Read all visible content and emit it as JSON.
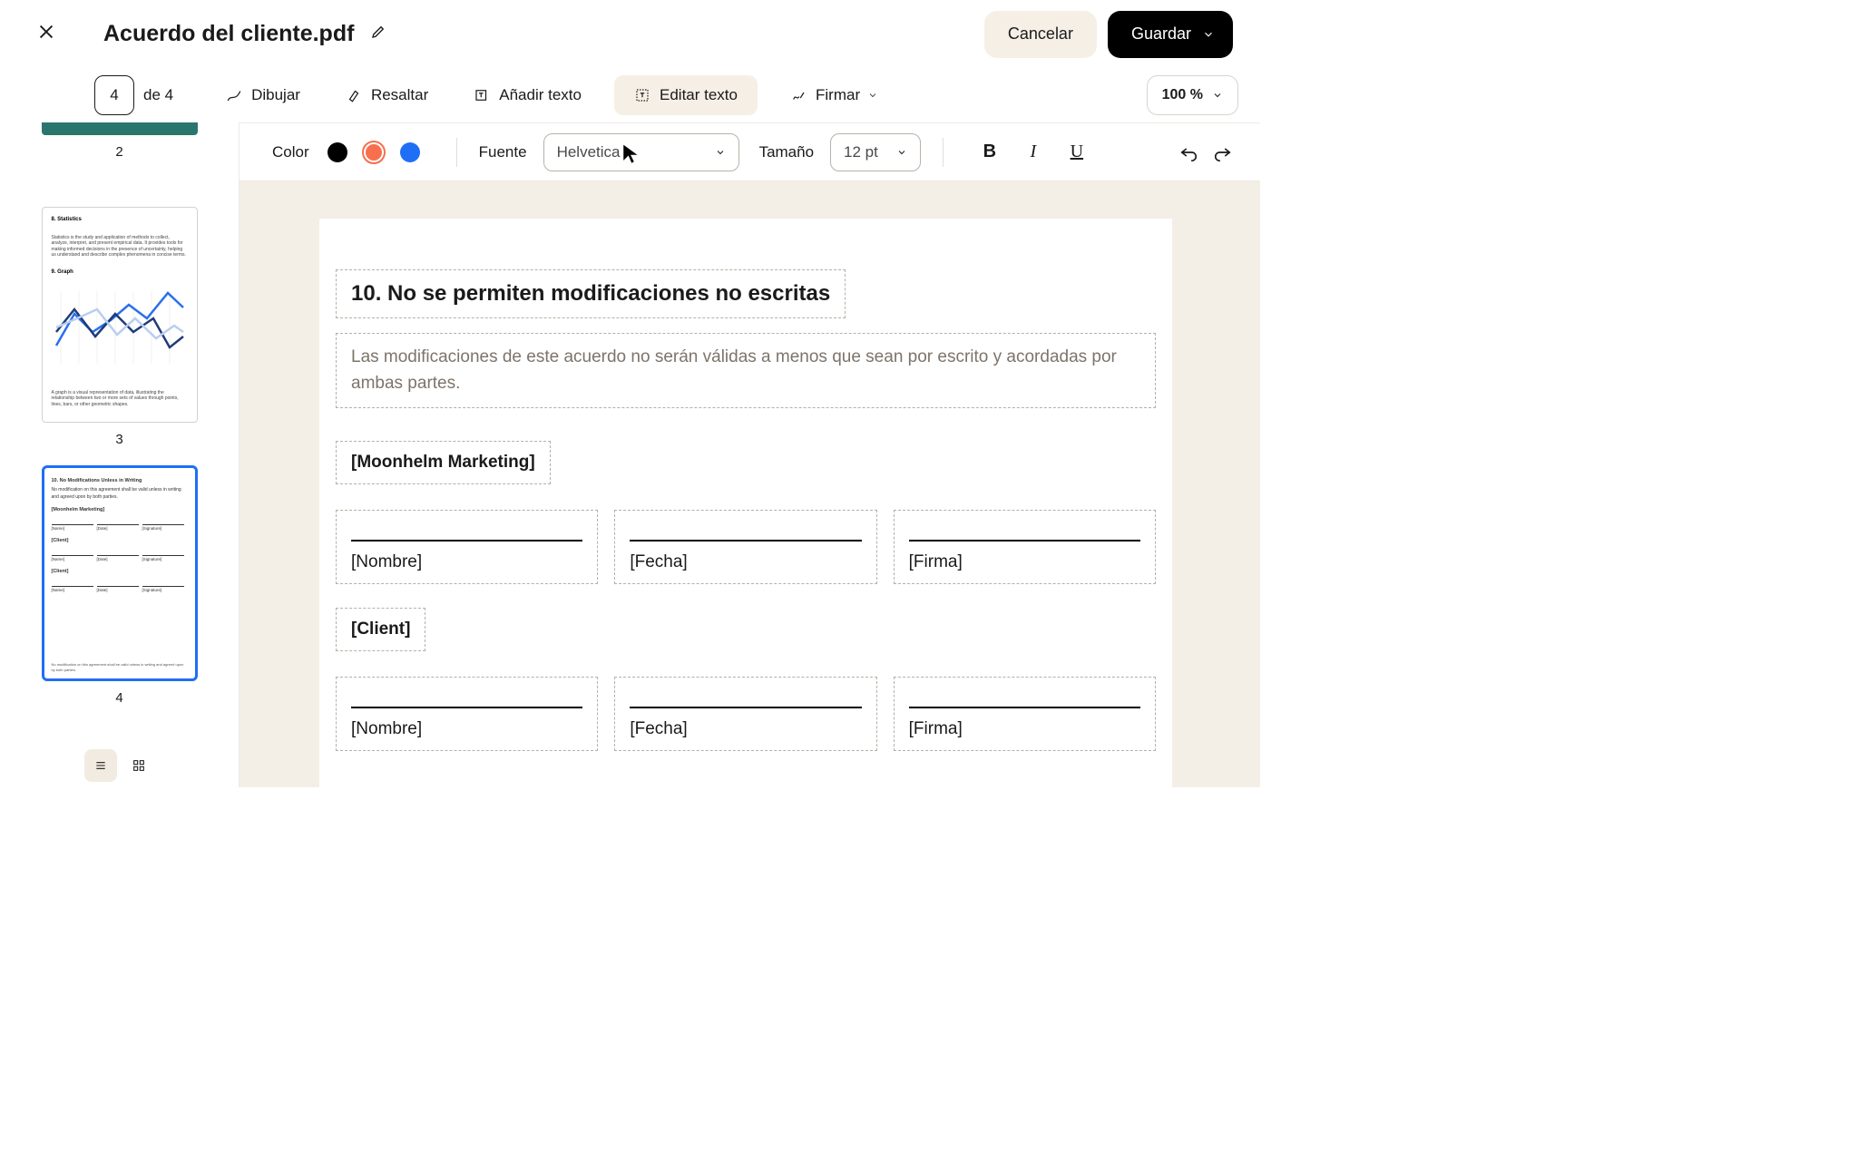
{
  "header": {
    "filename": "Acuerdo del cliente.pdf",
    "cancel_label": "Cancelar",
    "save_label": "Guardar"
  },
  "toolbar": {
    "current_page": "4",
    "page_of": "de 4",
    "draw": "Dibujar",
    "highlight": "Resaltar",
    "add_text": "Añadir texto",
    "edit_text": "Editar texto",
    "sign": "Firmar",
    "zoom": "100 %"
  },
  "formatbar": {
    "color_label": "Color",
    "colors": {
      "black": "#000000",
      "orange": "#f86f4e",
      "blue": "#1f6ff5"
    },
    "font_label": "Fuente",
    "font_value": "Helvetica",
    "size_label": "Tamaño",
    "size_value": "12 pt"
  },
  "sidebar": {
    "page2_num": "2",
    "page3_num": "3",
    "page4_num": "4",
    "page3": {
      "h1": "8. Statistics",
      "p1": "Statistics is the study and application of methods to collect, analyze, interpret, and present empirical data. It provides tools for making informed decisions in the presence of uncertainty, helping us understand and describe complex phenomena in concise terms.",
      "h2": "9. Graph",
      "p2": "A graph is a visual representation of data, illustrating the relationship between two or more sets of values through points, lines, bars, or other geometric shapes."
    },
    "page4": {
      "h": "10. No Modifications Unless in Writing",
      "p": "No modification on this agreement shall be valid unless in writing and agreed upon by both parties.",
      "company": "[Moonhelm Marketing]",
      "client": "[Client]",
      "name": "[Name]",
      "date": "[Date]",
      "signature": "[Signature]",
      "footer": "No modification on this agreement shall be valid unless in writing and agreed upon by both parties."
    }
  },
  "document": {
    "heading": "10. No se permiten modificaciones no escritas",
    "paragraph": "Las modificaciones de este acuerdo no serán válidas a menos que sean por escrito y acordadas por ambas partes.",
    "company": "[Moonhelm Marketing]",
    "client": "[Client]",
    "name_label": "[Nombre]",
    "date_label": "[Fecha]",
    "signature_label": "[Firma]"
  }
}
